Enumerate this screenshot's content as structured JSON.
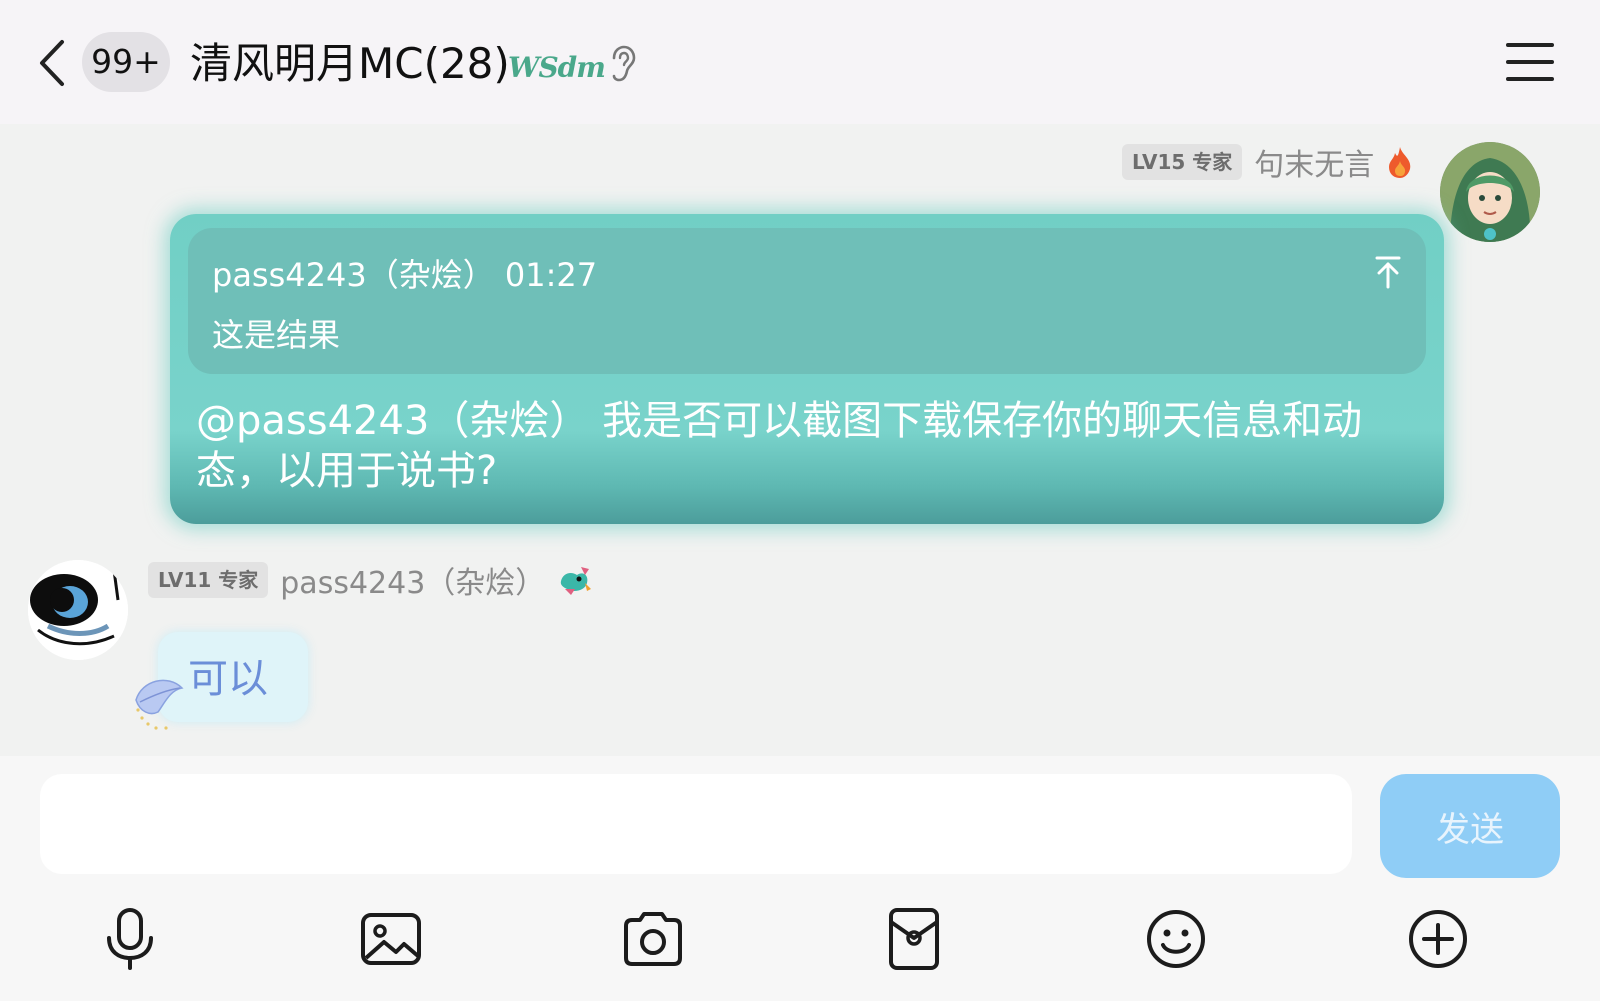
{
  "header": {
    "unread_count": "99+",
    "title": "清风明月MC(28)",
    "group_tag": "WSdm"
  },
  "messages": [
    {
      "direction": "outgoing",
      "sender_level": "LV15 专家",
      "sender_name": "句末无言",
      "quote": {
        "meta": "pass4243（杂烩） 01:27",
        "text": "这是结果"
      },
      "text": "@pass4243（杂烩） 我是否可以截图下载保存你的聊天信息和动态，以用于说书?"
    },
    {
      "direction": "incoming",
      "sender_level": "LV11 专家",
      "sender_name": "pass4243（杂烩）",
      "text": "可以"
    }
  ],
  "composer": {
    "value": "",
    "send_label": "发送"
  },
  "toolbar": [
    "microphone-icon",
    "image-icon",
    "camera-icon",
    "red-packet-icon",
    "emoji-icon",
    "plus-icon"
  ],
  "colors": {
    "outgoing_bubble": "#71cfc5",
    "quote_box": "#6fbfb8",
    "incoming_bubble": "#dff4f9",
    "send_button": "#8fcdf6"
  }
}
